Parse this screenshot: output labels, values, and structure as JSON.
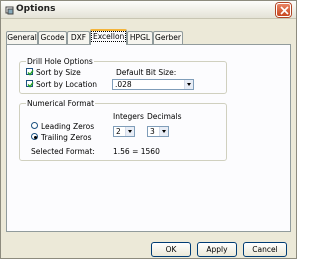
{
  "window": {
    "title": "Options"
  },
  "tabs": [
    {
      "label": "General"
    },
    {
      "label": "Gcode"
    },
    {
      "label": "DXF"
    },
    {
      "label": "Excellon"
    },
    {
      "label": "HPGL"
    },
    {
      "label": "Gerber"
    }
  ],
  "drill_hole": {
    "title": "Drill Hole Options",
    "sort_by_size": {
      "label": "Sort by Size",
      "checked": true
    },
    "sort_by_location": {
      "label": "Sort by Location",
      "checked": true
    },
    "default_bit_size": {
      "label": "Default Bit Size:",
      "value": ".028"
    }
  },
  "numerical_format": {
    "title": "Numerical Format",
    "leading_zeros": {
      "label": "Leading Zeros",
      "selected": false
    },
    "trailing_zeros": {
      "label": "Trailing Zeros",
      "selected": true
    },
    "integers": {
      "label": "Integers",
      "value": "2"
    },
    "decimals": {
      "label": "Decimals",
      "value": "3"
    },
    "selected_format_label": "Selected Format:",
    "selected_format_value": "1.56 = 1560"
  },
  "buttons": {
    "ok": "OK",
    "apply": "Apply",
    "cancel": "Cancel"
  }
}
